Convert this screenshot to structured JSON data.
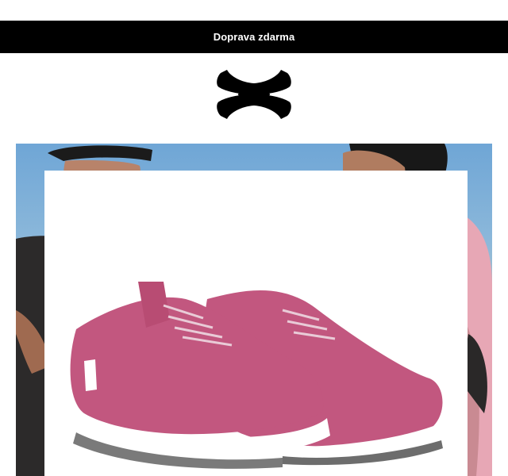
{
  "promo": {
    "text": "Doprava zdarma"
  },
  "brand": {
    "logo": "under-armour-logo-icon",
    "color": "#000000"
  },
  "hero": {
    "image": "runners-photo"
  },
  "product": {
    "image": "pink-training-shoes",
    "color": "#c2577f"
  }
}
